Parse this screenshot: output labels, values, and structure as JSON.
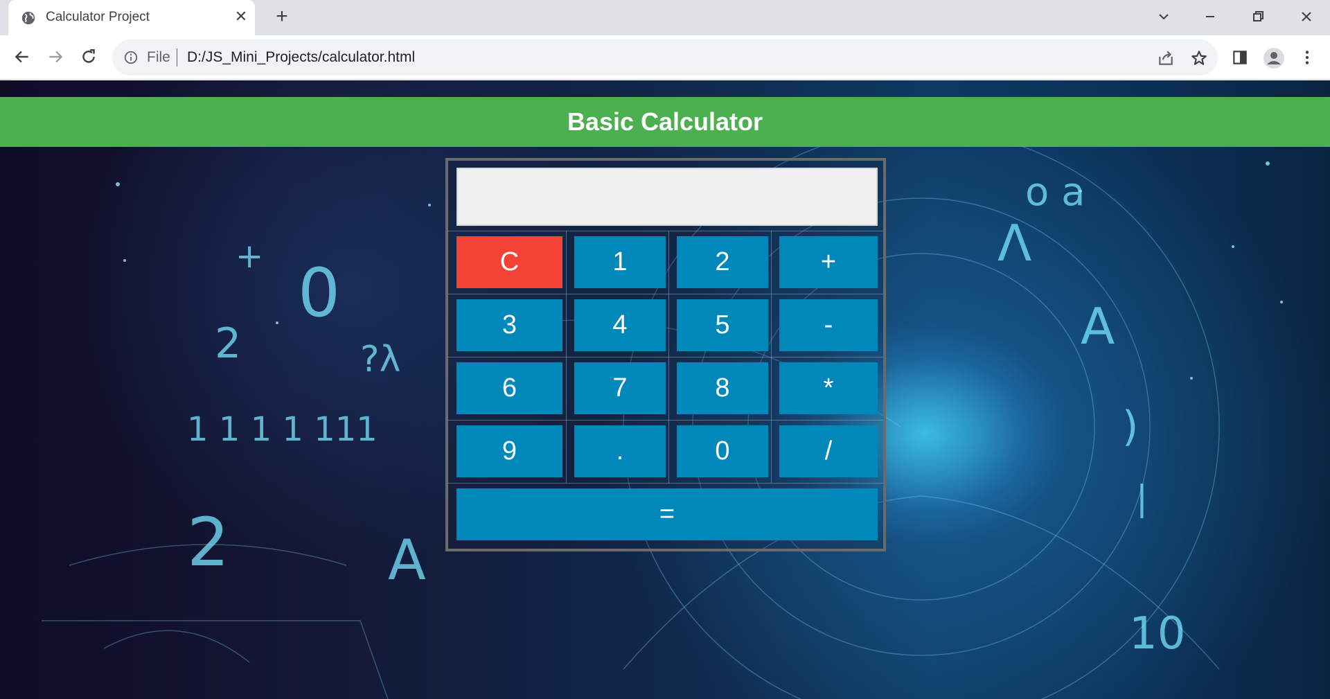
{
  "browser": {
    "tab_title": "Calculator Project",
    "tab_close": "✕",
    "new_tab": "+",
    "address_scheme": "File",
    "address_url": "D:/JS_Mini_Projects/calculator.html"
  },
  "page": {
    "heading": "Basic Calculator"
  },
  "calculator": {
    "display_value": "",
    "keys": {
      "clear": "C",
      "k1": "1",
      "k2": "2",
      "plus": "+",
      "k3": "3",
      "k4": "4",
      "k5": "5",
      "minus": "-",
      "k6": "6",
      "k7": "7",
      "k8": "8",
      "multiply": "*",
      "k9": "9",
      "dot": ".",
      "k0": "0",
      "divide": "/",
      "equals": "="
    }
  },
  "colors": {
    "header_green": "#4caf50",
    "key_blue": "#0088bb",
    "clear_red": "#f44336",
    "display_bg": "#f0f0f0"
  }
}
